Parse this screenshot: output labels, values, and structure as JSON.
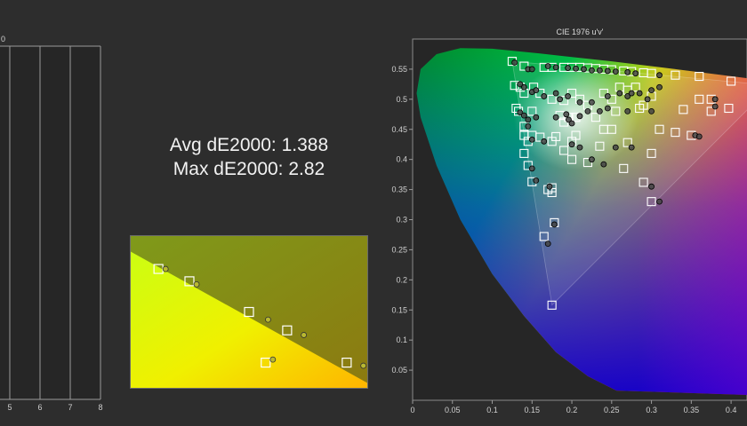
{
  "stats": {
    "avg_label": "Avg dE2000: 1.388",
    "max_label": "Max dE2000: 2.82"
  },
  "left_chart": {
    "top_tick": "0",
    "x_ticks": [
      "5",
      "6",
      "7",
      "8"
    ]
  },
  "chart_data": [
    {
      "type": "scatter",
      "title": "CIE 1976 u'v'",
      "xlabel": "",
      "ylabel": "",
      "xlim": [
        0,
        0.42
      ],
      "ylim": [
        0,
        0.6
      ],
      "x_ticks": [
        "0",
        "0.05",
        "0.1",
        "0.15",
        "0.2",
        "0.25",
        "0.3",
        "0.35",
        "0.4"
      ],
      "y_ticks": [
        "0.05",
        "0.1",
        "0.15",
        "0.2",
        "0.25",
        "0.3",
        "0.35",
        "0.4",
        "0.45",
        "0.5",
        "0.55"
      ],
      "grid": false,
      "gamut_triangle": [
        [
          0.451,
          0.523
        ],
        [
          0.125,
          0.563
        ],
        [
          0.175,
          0.158
        ]
      ],
      "series": [
        {
          "role": "target",
          "marker": "square",
          "points": [
            [
              0.125,
              0.563
            ],
            [
              0.14,
              0.555
            ],
            [
              0.165,
              0.553
            ],
            [
              0.175,
              0.553
            ],
            [
              0.19,
              0.553
            ],
            [
              0.2,
              0.553
            ],
            [
              0.21,
              0.553
            ],
            [
              0.22,
              0.552
            ],
            [
              0.23,
              0.551
            ],
            [
              0.24,
              0.55
            ],
            [
              0.25,
              0.549
            ],
            [
              0.265,
              0.547
            ],
            [
              0.275,
              0.546
            ],
            [
              0.29,
              0.544
            ],
            [
              0.3,
              0.543
            ],
            [
              0.33,
              0.54
            ],
            [
              0.36,
              0.538
            ],
            [
              0.4,
              0.53
            ],
            [
              0.128,
              0.523
            ],
            [
              0.135,
              0.52
            ],
            [
              0.14,
              0.51
            ],
            [
              0.152,
              0.52
            ],
            [
              0.16,
              0.51
            ],
            [
              0.175,
              0.5
            ],
            [
              0.19,
              0.498
            ],
            [
              0.2,
              0.51
            ],
            [
              0.21,
              0.5
            ],
            [
              0.22,
              0.49
            ],
            [
              0.24,
              0.51
            ],
            [
              0.25,
              0.5
            ],
            [
              0.26,
              0.52
            ],
            [
              0.27,
              0.515
            ],
            [
              0.28,
              0.52
            ],
            [
              0.3,
              0.505
            ],
            [
              0.29,
              0.49
            ],
            [
              0.36,
              0.5
            ],
            [
              0.375,
              0.5
            ],
            [
              0.397,
              0.485
            ],
            [
              0.13,
              0.485
            ],
            [
              0.133,
              0.48
            ],
            [
              0.15,
              0.48
            ],
            [
              0.185,
              0.473
            ],
            [
              0.19,
              0.462
            ],
            [
              0.196,
              0.47
            ],
            [
              0.205,
              0.47
            ],
            [
              0.23,
              0.47
            ],
            [
              0.255,
              0.48
            ],
            [
              0.285,
              0.485
            ],
            [
              0.34,
              0.483
            ],
            [
              0.375,
              0.48
            ],
            [
              0.14,
              0.455
            ],
            [
              0.15,
              0.44
            ],
            [
              0.16,
              0.437
            ],
            [
              0.18,
              0.438
            ],
            [
              0.205,
              0.44
            ],
            [
              0.24,
              0.45
            ],
            [
              0.25,
              0.45
            ],
            [
              0.31,
              0.45
            ],
            [
              0.33,
              0.445
            ],
            [
              0.35,
              0.44
            ],
            [
              0.14,
              0.44
            ],
            [
              0.145,
              0.43
            ],
            [
              0.175,
              0.43
            ],
            [
              0.2,
              0.43
            ],
            [
              0.19,
              0.415
            ],
            [
              0.235,
              0.422
            ],
            [
              0.27,
              0.428
            ],
            [
              0.145,
              0.39
            ],
            [
              0.2,
              0.4
            ],
            [
              0.22,
              0.395
            ],
            [
              0.265,
              0.385
            ],
            [
              0.14,
              0.41
            ],
            [
              0.3,
              0.41
            ],
            [
              0.15,
              0.363
            ],
            [
              0.175,
              0.353
            ],
            [
              0.175,
              0.345
            ],
            [
              0.17,
              0.35
            ],
            [
              0.29,
              0.362
            ],
            [
              0.3,
              0.33
            ],
            [
              0.178,
              0.295
            ],
            [
              0.165,
              0.272
            ],
            [
              0.175,
              0.158
            ]
          ]
        },
        {
          "role": "measured",
          "marker": "circle",
          "points": [
            [
              0.128,
              0.561
            ],
            [
              0.145,
              0.55
            ],
            [
              0.15,
              0.55
            ],
            [
              0.17,
              0.555
            ],
            [
              0.18,
              0.553
            ],
            [
              0.195,
              0.552
            ],
            [
              0.205,
              0.551
            ],
            [
              0.215,
              0.55
            ],
            [
              0.225,
              0.548
            ],
            [
              0.235,
              0.548
            ],
            [
              0.245,
              0.547
            ],
            [
              0.255,
              0.546
            ],
            [
              0.27,
              0.545
            ],
            [
              0.28,
              0.543
            ],
            [
              0.31,
              0.54
            ],
            [
              0.135,
              0.525
            ],
            [
              0.14,
              0.52
            ],
            [
              0.15,
              0.512
            ],
            [
              0.155,
              0.515
            ],
            [
              0.165,
              0.505
            ],
            [
              0.18,
              0.51
            ],
            [
              0.185,
              0.5
            ],
            [
              0.195,
              0.505
            ],
            [
              0.21,
              0.495
            ],
            [
              0.225,
              0.495
            ],
            [
              0.245,
              0.505
            ],
            [
              0.26,
              0.51
            ],
            [
              0.27,
              0.505
            ],
            [
              0.275,
              0.51
            ],
            [
              0.285,
              0.51
            ],
            [
              0.295,
              0.5
            ],
            [
              0.3,
              0.515
            ],
            [
              0.31,
              0.52
            ],
            [
              0.38,
              0.5
            ],
            [
              0.38,
              0.488
            ],
            [
              0.135,
              0.478
            ],
            [
              0.14,
              0.473
            ],
            [
              0.145,
              0.466
            ],
            [
              0.155,
              0.47
            ],
            [
              0.18,
              0.47
            ],
            [
              0.193,
              0.475
            ],
            [
              0.196,
              0.466
            ],
            [
              0.2,
              0.46
            ],
            [
              0.21,
              0.472
            ],
            [
              0.22,
              0.48
            ],
            [
              0.235,
              0.48
            ],
            [
              0.245,
              0.485
            ],
            [
              0.27,
              0.48
            ],
            [
              0.3,
              0.48
            ],
            [
              0.355,
              0.44
            ],
            [
              0.36,
              0.438
            ],
            [
              0.145,
              0.455
            ],
            [
              0.15,
              0.433
            ],
            [
              0.165,
              0.43
            ],
            [
              0.2,
              0.425
            ],
            [
              0.21,
              0.42
            ],
            [
              0.225,
              0.4
            ],
            [
              0.24,
              0.392
            ],
            [
              0.255,
              0.42
            ],
            [
              0.275,
              0.42
            ],
            [
              0.15,
              0.385
            ],
            [
              0.155,
              0.365
            ],
            [
              0.172,
              0.355
            ],
            [
              0.3,
              0.355
            ],
            [
              0.31,
              0.33
            ],
            [
              0.17,
              0.26
            ],
            [
              0.178,
              0.292
            ]
          ]
        }
      ]
    },
    {
      "type": "scatter",
      "title": "",
      "xlabel": "",
      "ylabel": "",
      "note": "zoomed detail, no axis labels",
      "series": [
        {
          "role": "target",
          "marker": "square",
          "points": [
            [
              0.12,
              0.78
            ],
            [
              0.25,
              0.7
            ],
            [
              0.5,
              0.5
            ],
            [
              0.66,
              0.38
            ],
            [
              0.57,
              0.17
            ],
            [
              0.91,
              0.17
            ]
          ]
        },
        {
          "role": "measured",
          "marker": "circle",
          "points": [
            [
              0.15,
              0.78
            ],
            [
              0.28,
              0.68
            ],
            [
              0.58,
              0.45
            ],
            [
              0.73,
              0.35
            ],
            [
              0.6,
              0.19
            ],
            [
              0.98,
              0.15
            ]
          ]
        }
      ]
    }
  ]
}
